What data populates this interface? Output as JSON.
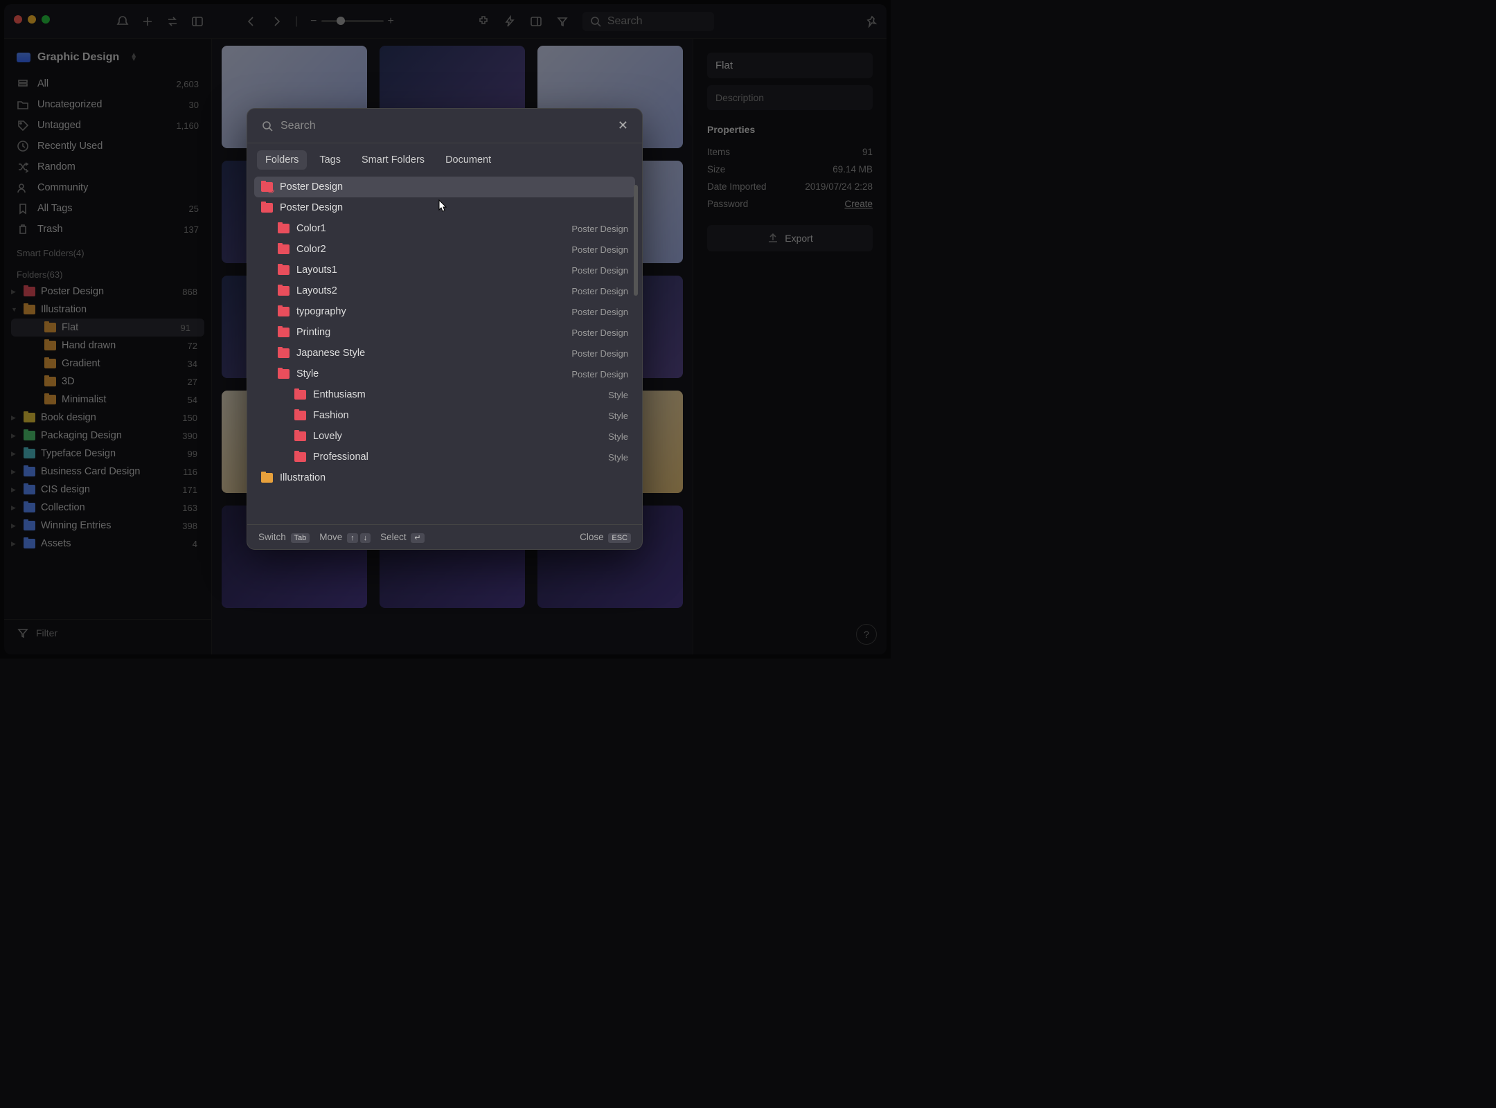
{
  "library_name": "Graphic Design",
  "toolbar": {
    "search_placeholder": "Search"
  },
  "sidebar": {
    "nav": [
      {
        "label": "All",
        "count": "2,603",
        "icon": "stack"
      },
      {
        "label": "Uncategorized",
        "count": "30",
        "icon": "folder"
      },
      {
        "label": "Untagged",
        "count": "1,160",
        "icon": "tag"
      },
      {
        "label": "Recently Used",
        "count": "",
        "icon": "clock"
      },
      {
        "label": "Random",
        "count": "",
        "icon": "shuffle"
      },
      {
        "label": "Community",
        "count": "",
        "icon": "users"
      },
      {
        "label": "All Tags",
        "count": "25",
        "icon": "bookmark"
      },
      {
        "label": "Trash",
        "count": "137",
        "icon": "trash"
      }
    ],
    "smart_folders_label": "Smart Folders(4)",
    "folders_label": "Folders(63)",
    "folders": [
      {
        "label": "Poster Design",
        "count": "868",
        "color": "fc-red",
        "indent": 0,
        "disclosure": "▶"
      },
      {
        "label": "Illustration",
        "count": "",
        "color": "fc-orange",
        "indent": 0,
        "disclosure": "▼"
      },
      {
        "label": "Flat",
        "count": "91",
        "color": "fc-orange",
        "indent": 1,
        "active": true
      },
      {
        "label": "Hand drawn",
        "count": "72",
        "color": "fc-orange",
        "indent": 1
      },
      {
        "label": "Gradient",
        "count": "34",
        "color": "fc-orange",
        "indent": 1
      },
      {
        "label": "3D",
        "count": "27",
        "color": "fc-orange",
        "indent": 1
      },
      {
        "label": "Minimalist",
        "count": "54",
        "color": "fc-orange",
        "indent": 1
      },
      {
        "label": "Book design",
        "count": "150",
        "color": "fc-yellow",
        "indent": 0,
        "disclosure": "▶"
      },
      {
        "label": "Packaging Design",
        "count": "390",
        "color": "fc-green",
        "indent": 0,
        "disclosure": "▶"
      },
      {
        "label": "Typeface Design",
        "count": "99",
        "color": "fc-cyan",
        "indent": 0,
        "disclosure": "▶"
      },
      {
        "label": "Business Card Design",
        "count": "116",
        "color": "fc-blue",
        "indent": 0,
        "disclosure": "▶"
      },
      {
        "label": "CIS design",
        "count": "171",
        "color": "fc-blue",
        "indent": 0,
        "disclosure": "▶"
      },
      {
        "label": "Collection",
        "count": "163",
        "color": "fc-blue",
        "indent": 0,
        "disclosure": "▶"
      },
      {
        "label": "Winning Entries",
        "count": "398",
        "color": "fc-blue",
        "indent": 0,
        "disclosure": "▶"
      },
      {
        "label": "Assets",
        "count": "4",
        "color": "fc-blue",
        "indent": 0,
        "disclosure": "▶"
      }
    ],
    "filter_label": "Filter"
  },
  "rightpanel": {
    "title": "Flat",
    "desc_placeholder": "Description",
    "section": "Properties",
    "props": [
      {
        "k": "Items",
        "v": "91"
      },
      {
        "k": "Size",
        "v": "69.14 MB"
      },
      {
        "k": "Date Imported",
        "v": "2019/07/24 2:28"
      },
      {
        "k": "Password",
        "v": "Create",
        "link": true
      }
    ],
    "export": "Export"
  },
  "modal": {
    "search_placeholder": "Search",
    "tabs": [
      "Folders",
      "Tags",
      "Smart Folders",
      "Document"
    ],
    "active_tab": 0,
    "rows": [
      {
        "label": "Poster Design",
        "parent": "",
        "color": "fc-red",
        "depth": 0,
        "highlighted": true,
        "recent": true
      },
      {
        "label": "Poster Design",
        "parent": "",
        "color": "fc-red",
        "depth": 0
      },
      {
        "label": "Color1",
        "parent": "Poster Design",
        "color": "fc-red",
        "depth": 1
      },
      {
        "label": "Color2",
        "parent": "Poster Design",
        "color": "fc-red",
        "depth": 1
      },
      {
        "label": "Layouts1",
        "parent": "Poster Design",
        "color": "fc-red",
        "depth": 1
      },
      {
        "label": "Layouts2",
        "parent": "Poster Design",
        "color": "fc-red",
        "depth": 1
      },
      {
        "label": "typography",
        "parent": "Poster Design",
        "color": "fc-red",
        "depth": 1
      },
      {
        "label": "Printing",
        "parent": "Poster Design",
        "color": "fc-red",
        "depth": 1
      },
      {
        "label": "Japanese Style",
        "parent": "Poster Design",
        "color": "fc-red",
        "depth": 1
      },
      {
        "label": "Style",
        "parent": "Poster Design",
        "color": "fc-red",
        "depth": 1
      },
      {
        "label": "Enthusiasm",
        "parent": "Style",
        "color": "fc-red",
        "depth": 2
      },
      {
        "label": "Fashion",
        "parent": "Style",
        "color": "fc-red",
        "depth": 2
      },
      {
        "label": "Lovely",
        "parent": "Style",
        "color": "fc-red",
        "depth": 2
      },
      {
        "label": "Professional",
        "parent": "Style",
        "color": "fc-red",
        "depth": 2
      },
      {
        "label": "Illustration",
        "parent": "",
        "color": "fc-orange",
        "depth": 0
      }
    ],
    "footer": {
      "switch": "Switch",
      "switch_key": "Tab",
      "move": "Move",
      "move_key1": "↑",
      "move_key2": "↓",
      "select": "Select",
      "select_key": "↵",
      "close": "Close",
      "close_key": "ESC"
    }
  }
}
